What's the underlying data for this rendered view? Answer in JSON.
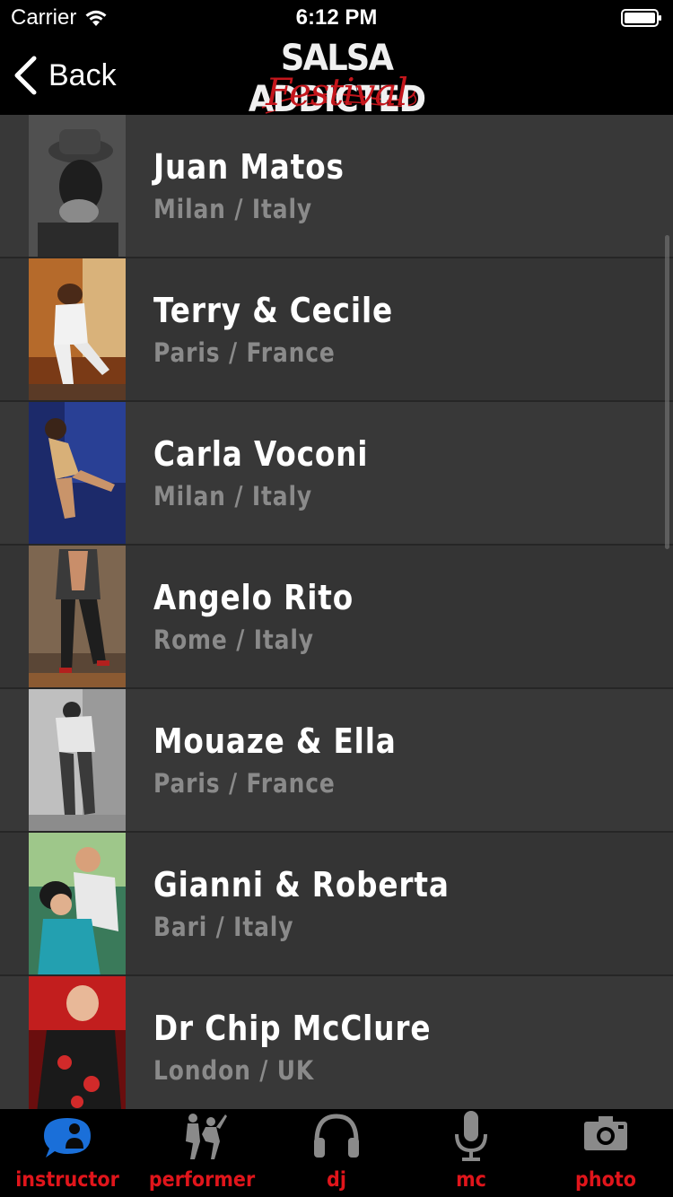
{
  "status_bar": {
    "carrier": "Carrier",
    "time": "6:12 PM"
  },
  "nav": {
    "back_label": "Back",
    "logo_line1": "SALSA ADDICTED",
    "logo_line2": "Festival"
  },
  "colors": {
    "accent": "#e0151b",
    "tab_active": "#1a6fd9",
    "tab_inactive": "#8a8a8a",
    "row_even": "#383838",
    "row_odd": "#343434",
    "subtitle": "#8a8a8a"
  },
  "instructors": [
    {
      "name": "Juan Matos",
      "location": "Milan / Italy",
      "photo_icon": "portrait-photo"
    },
    {
      "name": "Terry & Cecile",
      "location": "Paris / France",
      "photo_icon": "portrait-photo"
    },
    {
      "name": "Carla Voconi",
      "location": "Milan / Italy",
      "photo_icon": "portrait-photo"
    },
    {
      "name": "Angelo Rito",
      "location": "Rome / Italy",
      "photo_icon": "portrait-photo"
    },
    {
      "name": "Mouaze & Ella",
      "location": "Paris / France",
      "photo_icon": "portrait-photo"
    },
    {
      "name": "Gianni & Roberta",
      "location": "Bari / Italy",
      "photo_icon": "portrait-photo"
    },
    {
      "name": "Dr Chip McClure",
      "location": "London / UK",
      "photo_icon": "portrait-photo"
    }
  ],
  "tabs": [
    {
      "label": "instructor",
      "icon": "instructor-chat-icon",
      "active": true
    },
    {
      "label": "performer",
      "icon": "dancers-icon",
      "active": false
    },
    {
      "label": "dj",
      "icon": "headphones-icon",
      "active": false
    },
    {
      "label": "mc",
      "icon": "microphone-icon",
      "active": false
    },
    {
      "label": "photo",
      "icon": "camera-icon",
      "active": false
    }
  ]
}
